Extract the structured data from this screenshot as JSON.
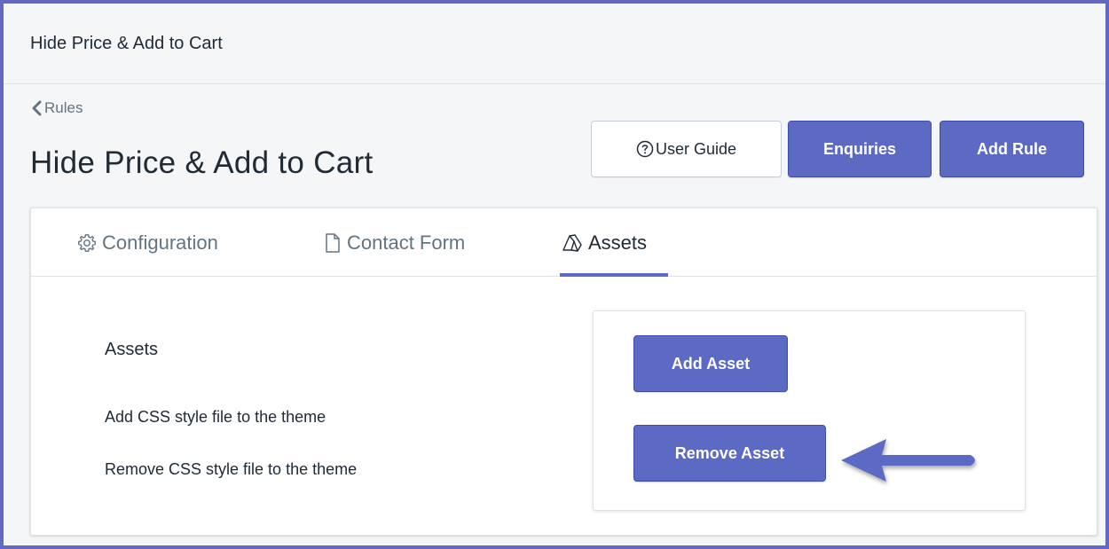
{
  "app": {
    "title": "Hide Price & Add to Cart"
  },
  "breadcrumb": {
    "label": "Rules"
  },
  "page": {
    "title": "Hide Price & Add to Cart"
  },
  "actions": {
    "user_guide": "User Guide",
    "enquiries": "Enquiries",
    "add_rule": "Add Rule"
  },
  "tabs": [
    {
      "label": "Configuration",
      "icon": "gear-icon",
      "active": false
    },
    {
      "label": "Contact Form",
      "icon": "document-icon",
      "active": false
    },
    {
      "label": "Assets",
      "icon": "assets-icon",
      "active": true
    }
  ],
  "assets_section": {
    "heading": "Assets",
    "description_add": "Add CSS style file to the theme",
    "description_remove": "Remove CSS style file to the theme",
    "add_button": "Add Asset",
    "remove_button": "Remove Asset"
  },
  "colors": {
    "accent": "#5c6ac4",
    "frame_border": "#6269c3",
    "text": "#212b36",
    "muted_text": "#637381"
  }
}
